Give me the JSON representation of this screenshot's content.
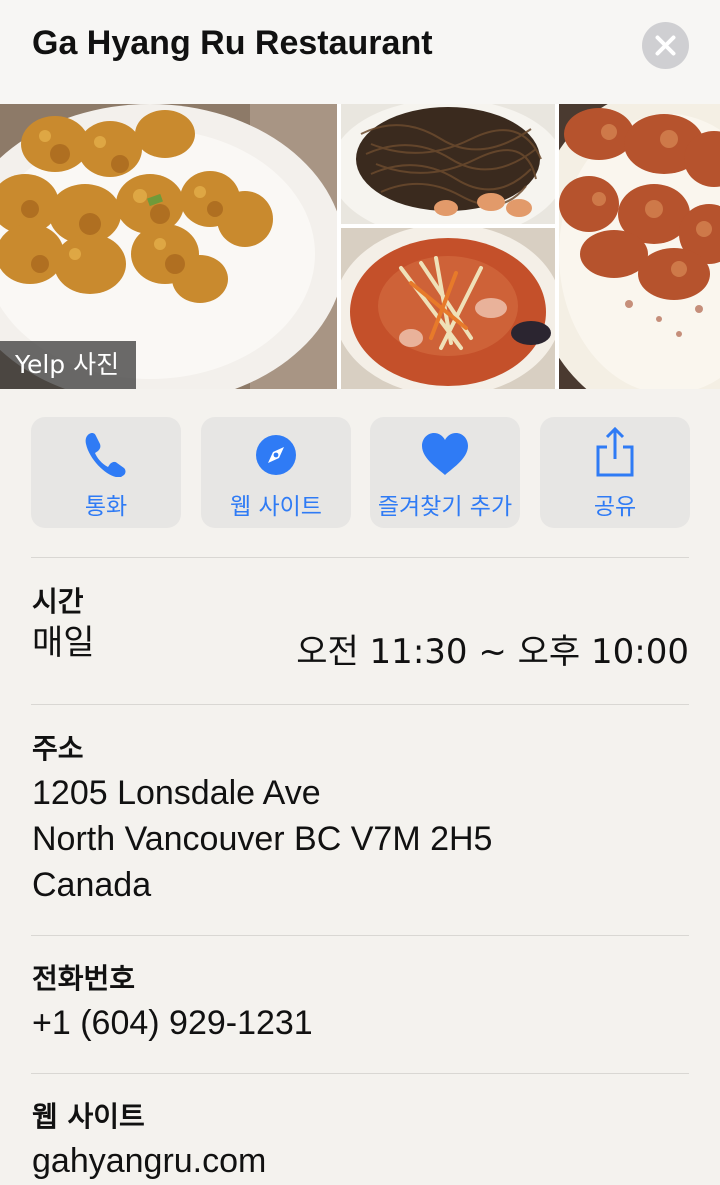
{
  "header": {
    "title": "Ga Hyang Ru Restaurant"
  },
  "photos": {
    "badge": "Yelp 사진"
  },
  "actions": [
    {
      "label": "통화",
      "icon": "phone-icon"
    },
    {
      "label": "웹 사이트",
      "icon": "compass-icon"
    },
    {
      "label": "즐겨찾기 추가",
      "icon": "heart-icon"
    },
    {
      "label": "공유",
      "icon": "share-icon"
    }
  ],
  "hours": {
    "label": "시간",
    "days": "매일",
    "time": "오전 11:30 ~ 오후 10:00"
  },
  "address": {
    "label": "주소",
    "line1": "1205 Lonsdale Ave",
    "line2": "North Vancouver BC V7M 2H5",
    "line3": "Canada"
  },
  "phone": {
    "label": "전화번호",
    "value": "+1 (604) 929-1231"
  },
  "website": {
    "label": "웹 사이트",
    "value": "gahyangru.com"
  },
  "colors": {
    "accent": "#2f7bf5",
    "background": "#f4f2ee",
    "button_bg": "#e7e6e4"
  }
}
